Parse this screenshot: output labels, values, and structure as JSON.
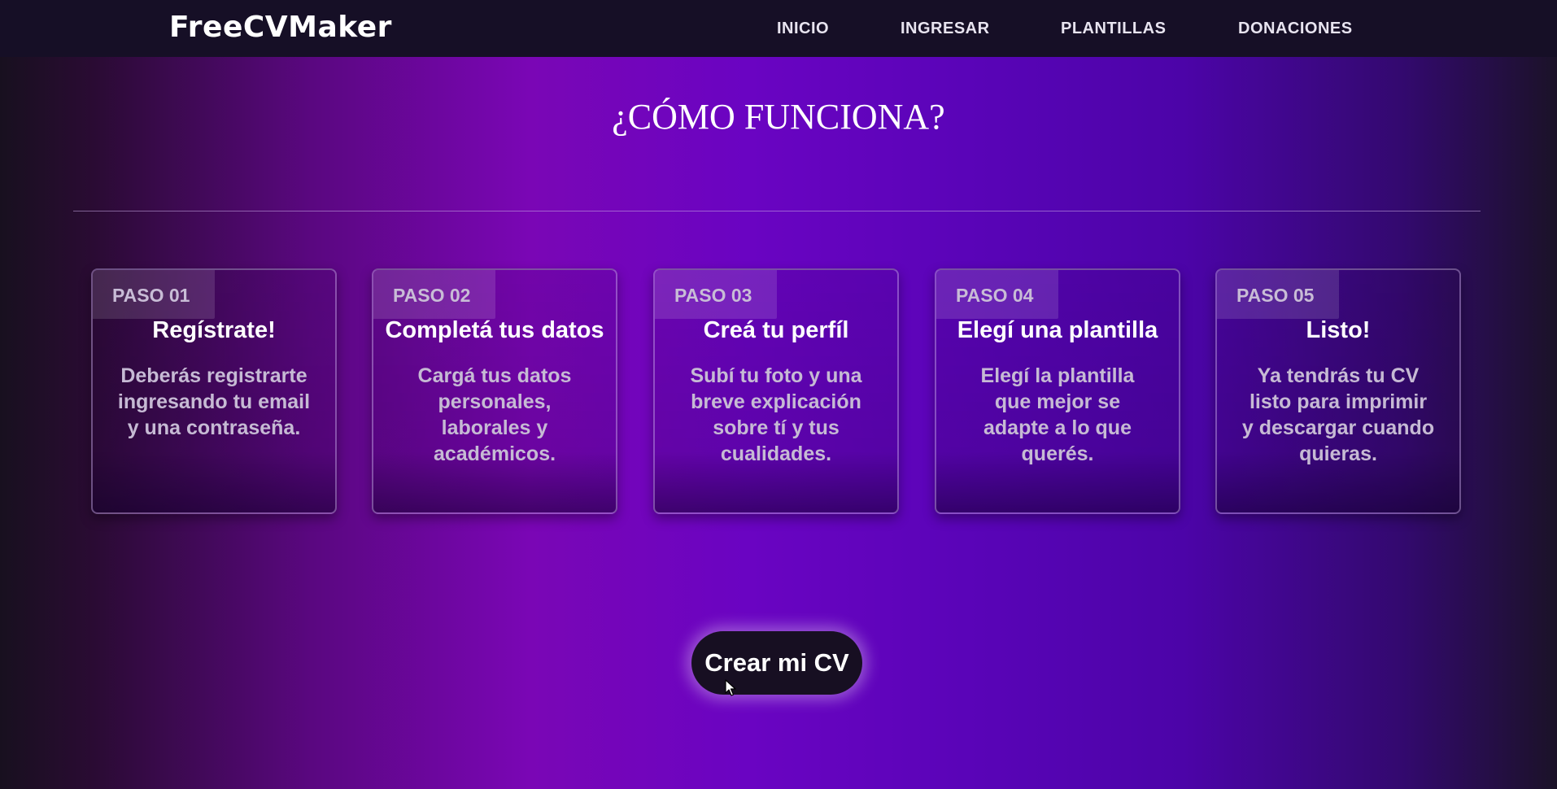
{
  "brand": {
    "logo_text": "FreeCVMaker"
  },
  "nav": {
    "items": [
      {
        "label": "INICIO"
      },
      {
        "label": "INGRESAR"
      },
      {
        "label": "PLANTILLAS"
      },
      {
        "label": "DONACIONES"
      }
    ]
  },
  "main": {
    "title": "¿CÓMO FUNCIONA?",
    "steps": [
      {
        "badge": "PASO 01",
        "title": "Regístrate!",
        "description": "Deberás registrarte ingresando tu email y una contraseña."
      },
      {
        "badge": "PASO 02",
        "title": "Completá tus datos",
        "description": "Cargá tus datos personales, laborales y académicos."
      },
      {
        "badge": "PASO 03",
        "title": "Creá tu perfíl",
        "description": "Subí tu foto y una breve explicación sobre tí y tus cualidades."
      },
      {
        "badge": "PASO 04",
        "title": "Elegí una plantilla",
        "description": "Elegí la plantilla que mejor se adapte a lo que querés."
      },
      {
        "badge": "PASO 05",
        "title": "Listo!",
        "description": "Ya tendrás tu CV listo para imprimir y descargar cuando quieras."
      }
    ],
    "cta_label": "Crear mi CV"
  },
  "colors": {
    "navbar_bg": "#160f26",
    "button_bg": "#170f22",
    "accent_purple": "#7a06b5"
  }
}
